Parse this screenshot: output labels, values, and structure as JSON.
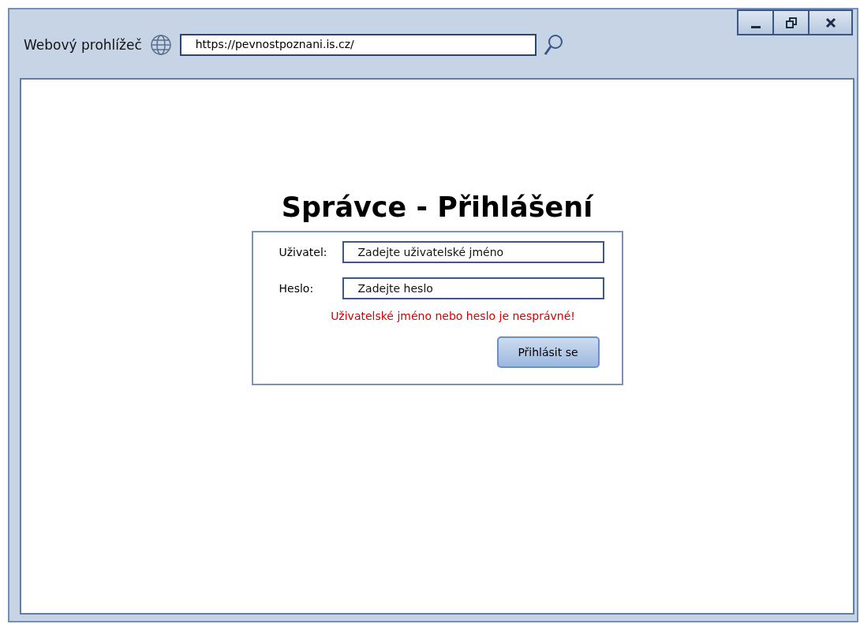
{
  "window": {
    "title": "Webový prohlížeč",
    "address": "https://pevnostpoznani.is.cz/"
  },
  "login": {
    "heading": "Správce - Přihlášení",
    "fields": [
      {
        "label": "Uživatel:",
        "placeholder": "Zadejte uživatelské jméno"
      },
      {
        "label": "Heslo:",
        "placeholder": "Zadejte heslo"
      }
    ],
    "error": "Uživatelské jméno nebo heslo je nesprávné!",
    "button": "Přihlásit se"
  }
}
